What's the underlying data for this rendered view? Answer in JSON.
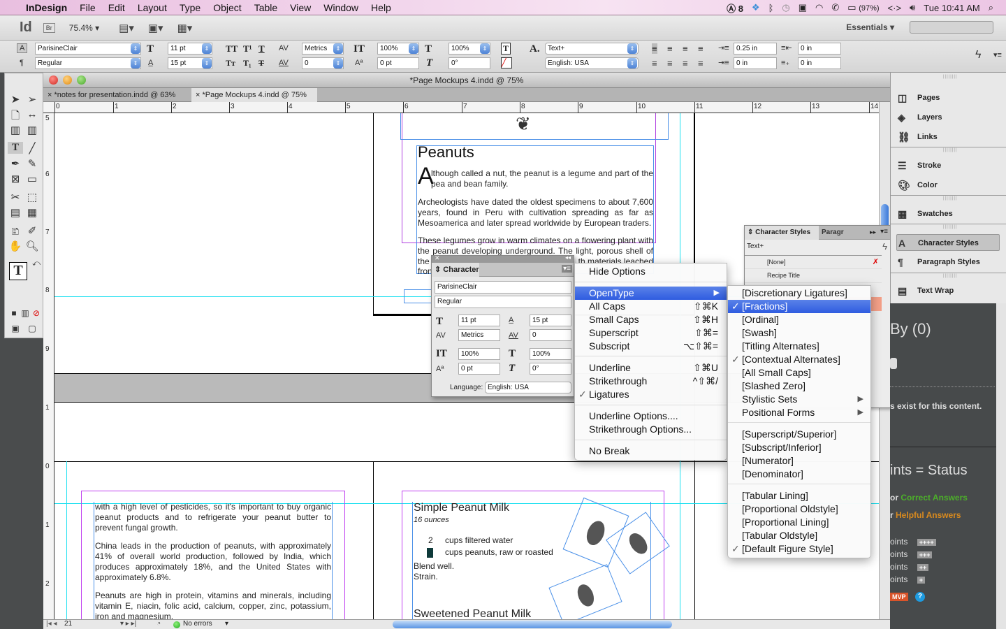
{
  "menubar": {
    "apple": "",
    "app": "InDesign",
    "items": [
      "File",
      "Edit",
      "Layout",
      "Type",
      "Object",
      "Table",
      "View",
      "Window",
      "Help"
    ],
    "status": {
      "adobe_count": "8",
      "battery": "(97%)",
      "arrows": "<·>",
      "clock": "Tue 10:41 AM"
    }
  },
  "appbar": {
    "logo": "Id",
    "bridge": "Br",
    "zoom": "75.4% ▾",
    "workspace": "Essentials ▾",
    "search_placeholder": ""
  },
  "control": {
    "font_family": "ParisineClair",
    "font_style": "Regular",
    "font_size": "11 pt",
    "leading": "15 pt",
    "kerning": "Metrics",
    "tracking": "0",
    "vscale": "100%",
    "hscale": "100%",
    "baseline": "0 pt",
    "skew": "0°",
    "char_style": "Text+",
    "language": "English: USA",
    "left_indent": "0.25 in",
    "right_indent": "0 in",
    "first_indent": "0 in",
    "last_indent": "0 in"
  },
  "document": {
    "title": "*Page Mockups 4.indd @ 75%",
    "tabs": [
      {
        "label": "*notes for presentation.indd @ 63%",
        "active": false
      },
      {
        "label": "*Page Mockups 4.indd @ 75%",
        "active": true
      }
    ],
    "hruler_labels": [
      "0",
      "1",
      "2",
      "3",
      "4",
      "5",
      "6",
      "7",
      "8",
      "9",
      "10",
      "11",
      "12",
      "13",
      "14"
    ],
    "vruler_labels": [
      "5",
      "6",
      "7",
      "8",
      "9",
      "1",
      "0",
      "1",
      "2"
    ],
    "page_number": "21",
    "preflight": "No errors"
  },
  "content": {
    "peanuts_title": "Peanuts",
    "dropcap": "A",
    "p1": "lthough called a nut, the peanut is a legume and part of the pea and bean family.",
    "p2": "Archeologists have dated the oldest specimens to about 7,600 years, found in Peru with cultivation spreading as far as Mesoamerica and later spread worldwide by European traders.",
    "p3": "These legumes grow in warm climates on a flowering plant with the peanut developing underground. The light, porous shell of the",
    "p3b": "th materials leached",
    "p3c": "fron",
    "lower_p1": "with a high level of pesticides, so it's important to buy organic peanut products and to refrigerate your peanut butter to prevent fungal growth.",
    "lower_p2": "China leads in the production of peanuts, with approximately 41% of overall world production, followed by India, which produces approximately 18%, and  the United States with approximately 6.8%.",
    "lower_p3": "Peanuts are high in protein, vitamins and minerals, including vitamin E, niacin, folic acid, calcium, copper, zinc, potassium, iron and magnesium.",
    "recipe1_title": "Simple Peanut Milk",
    "recipe1_yield": "16 ounces",
    "ing1_qty": "2",
    "ing1": "cups filtered water",
    "ing2_qty": "",
    "ing2": "cups peanuts, raw or roasted",
    "step1": "Blend well.",
    "step2": "Strain.",
    "recipe2_title": "Sweetened Peanut Milk"
  },
  "char_panel": {
    "title": "Character",
    "font_family": "ParisineClair",
    "font_style": "Regular",
    "size": "11 pt",
    "leading": "15 pt",
    "kerning": "Metrics",
    "tracking": "0",
    "vscale": "100%",
    "hscale": "100%",
    "baseline": "0 pt",
    "skew": "0°",
    "language_label": "Language:",
    "language": "English: USA"
  },
  "flyout_menu": {
    "items": [
      {
        "label": "Hide Options",
        "shortcut": ""
      },
      {
        "label": "OpenType",
        "shortcut": "",
        "submenu": true,
        "highlighted": true
      },
      {
        "label": "All Caps",
        "shortcut": "⇧⌘K"
      },
      {
        "label": "Small Caps",
        "shortcut": "⇧⌘H"
      },
      {
        "label": "Superscript",
        "shortcut": "⇧⌘="
      },
      {
        "label": "Subscript",
        "shortcut": "⌥⇧⌘="
      },
      {
        "label": "Underline",
        "shortcut": "⇧⌘U"
      },
      {
        "label": "Strikethrough",
        "shortcut": "^⇧⌘/"
      },
      {
        "label": "Ligatures",
        "shortcut": "",
        "checked": true
      },
      {
        "label": "Underline Options....",
        "shortcut": ""
      },
      {
        "label": "Strikethrough Options...",
        "shortcut": ""
      },
      {
        "label": "No Break",
        "shortcut": ""
      }
    ]
  },
  "opentype_menu": {
    "items": [
      {
        "label": "[Discretionary Ligatures]"
      },
      {
        "label": "[Fractions]",
        "checked": true,
        "highlighted": true
      },
      {
        "label": "[Ordinal]"
      },
      {
        "label": "[Swash]"
      },
      {
        "label": "[Titling Alternates]"
      },
      {
        "label": "[Contextual Alternates]",
        "checked": true
      },
      {
        "label": "[All Small Caps]"
      },
      {
        "label": "[Slashed Zero]"
      },
      {
        "label": "Stylistic Sets",
        "submenu": true
      },
      {
        "label": "Positional Forms",
        "submenu": true
      },
      {
        "label": "[Superscript/Superior]"
      },
      {
        "label": "[Subscript/Inferior]"
      },
      {
        "label": "[Numerator]"
      },
      {
        "label": "[Denominator]"
      },
      {
        "label": "[Tabular Lining]"
      },
      {
        "label": "[Proportional Oldstyle]"
      },
      {
        "label": "[Proportional Lining]"
      },
      {
        "label": "[Tabular Oldstyle]"
      },
      {
        "label": "[Default Figure Style]",
        "checked": true
      }
    ]
  },
  "char_styles_panel": {
    "tab1": "Character Styles",
    "tab2": "Paragr",
    "current": "Text+",
    "styles": [
      "[None]",
      "Recipe Title"
    ]
  },
  "right_panels": {
    "items": [
      "Pages",
      "Layers",
      "Links",
      "Stroke",
      "Color",
      "Swatches",
      "Character Styles",
      "Paragraph Styles",
      "Text Wrap"
    ],
    "active": "Character Styles"
  },
  "web_panel": {
    "by": "By (0)",
    "none_text": "s exist for this content.",
    "heading": "ints = Status",
    "correct_pre": "or ",
    "correct": "Correct Answers",
    "helpful_pre": "r ",
    "helpful": "Helpful Answers",
    "levels": [
      {
        "label": "oints",
        "badge": "++++"
      },
      {
        "label": "oints",
        "badge": "+++"
      },
      {
        "label": "oints",
        "badge": "++"
      },
      {
        "label": "oints",
        "badge": "+"
      }
    ],
    "mvp": "MVP",
    "help": "?",
    "colors": {
      "correct": "#4caf2a",
      "helpful": "#d98a1e",
      "mvp": "#d9542a",
      "help": "#1e9be0"
    }
  }
}
